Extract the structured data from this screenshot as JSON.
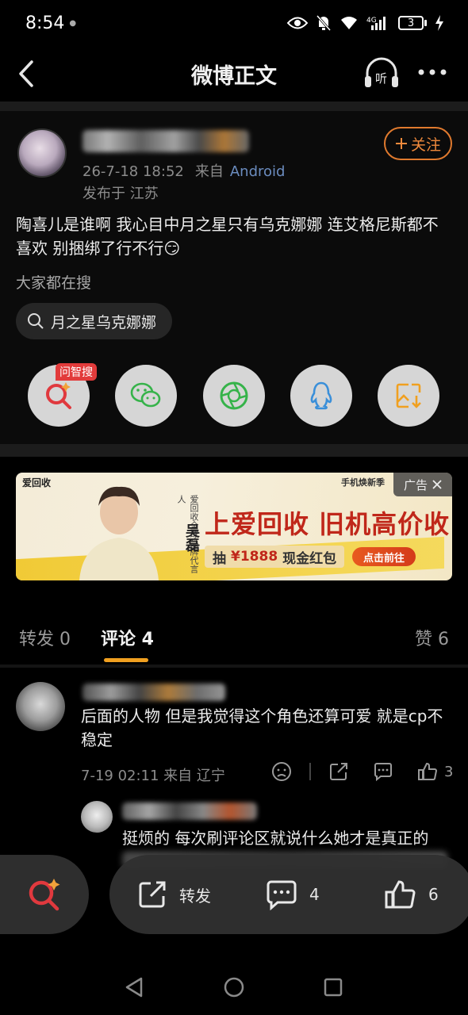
{
  "status_bar": {
    "time": "8:54",
    "battery": "3"
  },
  "header": {
    "title": "微博正文"
  },
  "post": {
    "meta_time": "26-7-18 18:52",
    "meta_from": "来自",
    "meta_source": "Android",
    "location": "发布于 江苏",
    "follow_label": "关注",
    "text": "陶喜儿是谁啊 我心目中月之星只有乌克娜娜 连艾格尼斯都不喜欢 别捆绑了行不行😏",
    "search_label": "大家都在搜",
    "search_chip": "月之星乌克娜娜",
    "share_badge": "问智搜"
  },
  "ad": {
    "brand": "爱回收",
    "top_right": "手机焕新季",
    "tag": "广告",
    "headline": "上爱回收 旧机高价收",
    "sub_prefix": "抽",
    "sub_amount": "¥1888",
    "sub_suffix": "现金红包",
    "cta": "点击前往",
    "endorser": "吴磊",
    "endorser_caption": "爱回收全球品牌代言人"
  },
  "tabs": [
    {
      "label": "转发 0"
    },
    {
      "label": "评论 4"
    },
    {
      "label": "赞 6"
    }
  ],
  "comments": [
    {
      "text": "后面的人物 但是我觉得这个角色还算可爱 就是cp不稳定",
      "meta": "7-19 02:11  来自 辽宁",
      "likes": "3"
    },
    {
      "text": "挺烦的 每次刷评论区就说什么她才是真正的"
    }
  ],
  "bottom_bar": {
    "repost_label": "转发",
    "comment_count": "4",
    "like_count": "6"
  },
  "colors": {
    "accent": "#f08a3c",
    "tab_underline": "#f0a020",
    "source_link": "#6b8cbf"
  }
}
